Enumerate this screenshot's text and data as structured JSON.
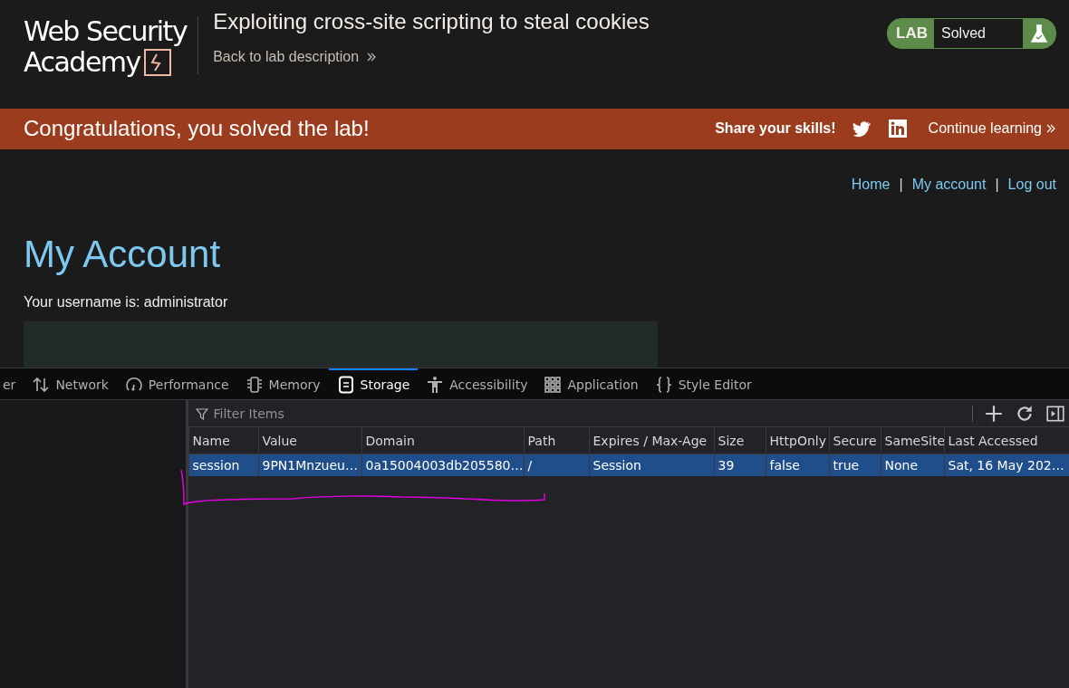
{
  "header": {
    "logo": [
      "Web Security",
      "Academy"
    ],
    "title": "Exploiting cross-site scripting to steal cookies",
    "back_link": "Back to lab description",
    "status": {
      "label": "LAB",
      "value": "Solved",
      "solved": true
    }
  },
  "banner": {
    "message": "Congratulations, you solved the lab!",
    "share_label": "Share your skills!",
    "continue_link": "Continue learning"
  },
  "nav": [
    {
      "kind": "link",
      "text": "Home"
    },
    {
      "kind": "separator",
      "text": "|"
    },
    {
      "kind": "link",
      "text": "My account"
    },
    {
      "kind": "separator",
      "text": "|"
    },
    {
      "kind": "link",
      "text": "Log out"
    }
  ],
  "page": {
    "heading": "My Account",
    "username_text": "Your username is: administrator"
  },
  "devtools": {
    "tabs": [
      {
        "label": "er",
        "selected": false
      },
      {
        "label": "Network",
        "selected": false
      },
      {
        "label": "Performance",
        "selected": false
      },
      {
        "label": "Memory",
        "selected": false
      },
      {
        "label": "Storage",
        "selected": true
      },
      {
        "label": "Accessibility",
        "selected": false
      },
      {
        "label": "Application",
        "selected": false
      },
      {
        "label": "Style Editor",
        "selected": false
      }
    ],
    "filter": {
      "placeholder": "Filter Items"
    },
    "table": {
      "columns": [
        "Name",
        "Value",
        "Domain",
        "Path",
        "Expires / Max-Age",
        "Size",
        "HttpOnly",
        "Secure",
        "SameSite",
        "Last Accessed"
      ],
      "rows": [
        {
          "selected": true,
          "cells": [
            "session",
            "9PN1Mnzueu…",
            "0a15004003db205580…",
            "/",
            "Session",
            "39",
            "false",
            "true",
            "None",
            "Sat, 16 May 202…"
          ]
        }
      ]
    }
  }
}
